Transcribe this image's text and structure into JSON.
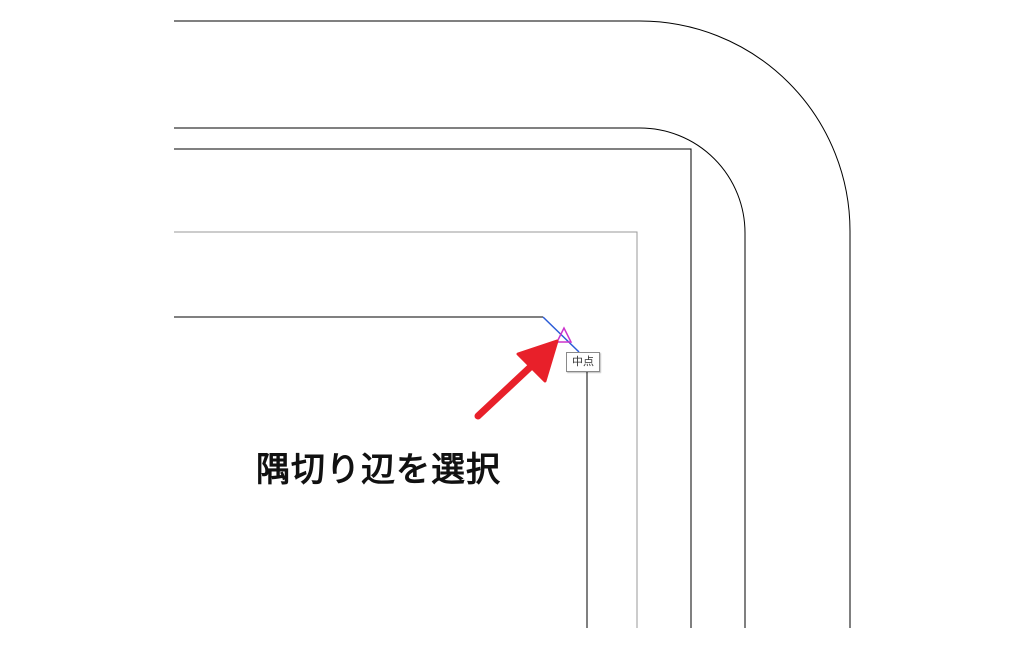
{
  "snap_tooltip": {
    "label": "中点",
    "marker_color": "#cc33cc"
  },
  "annotation": {
    "caption": "隅切り辺を選択",
    "arrow_color": "#e8202a"
  },
  "selected_edge_color": "#2a5bd7",
  "line_color": "#000000"
}
